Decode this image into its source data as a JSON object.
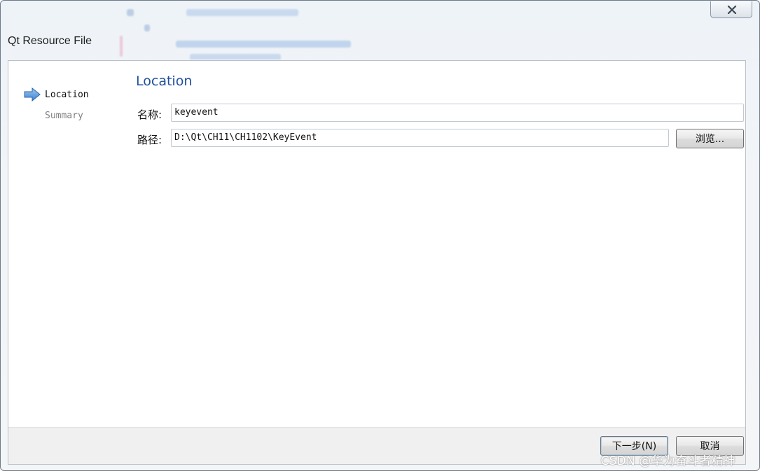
{
  "window": {
    "title": "Qt Resource File"
  },
  "wizard": {
    "steps": [
      {
        "label": "Location",
        "state": "current"
      },
      {
        "label": "Summary",
        "state": "pending"
      }
    ],
    "page_heading": "Location",
    "name_field": {
      "label": "名称:",
      "value": "keyevent"
    },
    "path_field": {
      "label": "路径:",
      "value": "D:\\Qt\\CH11\\CH1102\\KeyEvent"
    },
    "browse_label": "浏览..."
  },
  "footer": {
    "next_label": "下一步(N)",
    "cancel_label": "取消"
  },
  "watermark": "CSDN @华为奋斗者精神",
  "colors": {
    "heading": "#1f4f9c",
    "step_arrow": "#4a8fd8"
  },
  "icons": {
    "current_step": "arrow-right-icon",
    "close": "close-icon"
  }
}
